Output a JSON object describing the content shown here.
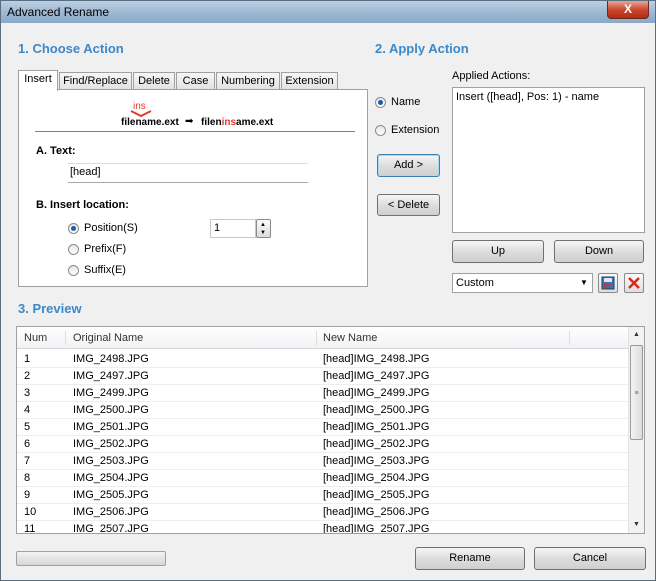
{
  "window": {
    "title": "Advanced Rename",
    "close_label": "X"
  },
  "sections": {
    "choose_action": "1. Choose Action",
    "apply_action": "2. Apply Action",
    "preview": "3. Preview"
  },
  "tabs": [
    {
      "label": "Insert",
      "active": true
    },
    {
      "label": "Find/Replace",
      "active": false
    },
    {
      "label": "Delete",
      "active": false
    },
    {
      "label": "Case",
      "active": false
    },
    {
      "label": "Numbering",
      "active": false
    },
    {
      "label": "Extension",
      "active": false
    }
  ],
  "insert_panel": {
    "illustration": {
      "ins_word": "ins",
      "before_name": "filename.ext",
      "after_prefix": "filen",
      "after_ins": "ins",
      "after_suffix": "ame.ext"
    },
    "text_label": "A. Text:",
    "text_value": "[head]",
    "location_label": "B. Insert location:",
    "location_options": [
      {
        "label": "Position(S)",
        "selected": true
      },
      {
        "label": "Prefix(F)",
        "selected": false
      },
      {
        "label": "Suffix(E)",
        "selected": false
      }
    ],
    "position_value": "1"
  },
  "apply_panel": {
    "target_options": [
      {
        "label": "Name",
        "selected": true
      },
      {
        "label": "Extension",
        "selected": false
      }
    ],
    "add_button": "Add >",
    "delete_button": "< Delete",
    "applied_actions_label": "Applied Actions:",
    "applied_actions": [
      "Insert ([head], Pos: 1) - name"
    ],
    "up_button": "Up",
    "down_button": "Down",
    "preset_value": "Custom",
    "icons": {
      "save": "save-icon",
      "delete": "delete-x-icon"
    },
    "delete_icon_color": "#d8281b"
  },
  "preview": {
    "columns": [
      "Num",
      "Original Name",
      "New Name"
    ],
    "rows": [
      [
        "1",
        "IMG_2498.JPG",
        "[head]IMG_2498.JPG"
      ],
      [
        "2",
        "IMG_2497.JPG",
        "[head]IMG_2497.JPG"
      ],
      [
        "3",
        "IMG_2499.JPG",
        "[head]IMG_2499.JPG"
      ],
      [
        "4",
        "IMG_2500.JPG",
        "[head]IMG_2500.JPG"
      ],
      [
        "5",
        "IMG_2501.JPG",
        "[head]IMG_2501.JPG"
      ],
      [
        "6",
        "IMG_2502.JPG",
        "[head]IMG_2502.JPG"
      ],
      [
        "7",
        "IMG_2503.JPG",
        "[head]IMG_2503.JPG"
      ],
      [
        "8",
        "IMG_2504.JPG",
        "[head]IMG_2504.JPG"
      ],
      [
        "9",
        "IMG_2505.JPG",
        "[head]IMG_2505.JPG"
      ],
      [
        "10",
        "IMG_2506.JPG",
        "[head]IMG_2506.JPG"
      ],
      [
        "11",
        "IMG_2507.JPG",
        "[head]IMG_2507.JPG"
      ]
    ]
  },
  "footer": {
    "rename_button": "Rename",
    "cancel_button": "Cancel"
  },
  "colors": {
    "section_title": "#3c88c9",
    "insert_highlight": "#e23b2e"
  }
}
